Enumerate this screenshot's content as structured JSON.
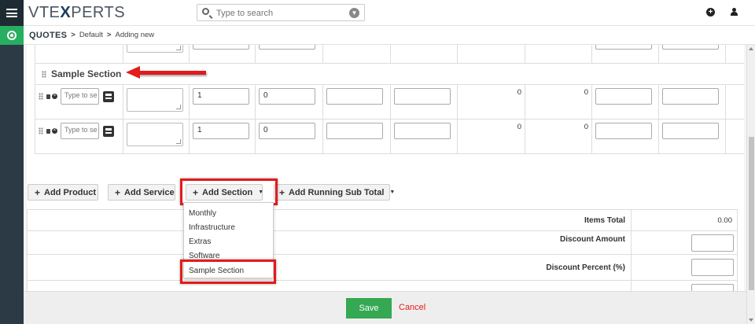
{
  "app": {
    "logo_prefix": "VTE",
    "logo_x": "X",
    "logo_suffix": "PERTS"
  },
  "search": {
    "placeholder": "Type to search"
  },
  "breadcrumb": {
    "module": "QUOTES",
    "sep1": ">",
    "item1": "Default",
    "sep2": ">",
    "item2": "Adding new"
  },
  "section": {
    "title": "Sample Section"
  },
  "rows": [
    {
      "product_placeholder": "Type to se",
      "quantity": "1",
      "list_price": "0",
      "total": "0",
      "net": "0"
    },
    {
      "product_placeholder": "Type to se",
      "quantity": "1",
      "list_price": "0",
      "total": "0",
      "net": "0"
    }
  ],
  "actions": {
    "add_product": "Add Product",
    "add_service": "Add Service",
    "add_section": "Add Section",
    "add_running_sub_total": "Add Running Sub Total"
  },
  "dropdown": {
    "options": [
      "Monthly",
      "Infrastructure",
      "Extras",
      "Software",
      "Sample Section"
    ]
  },
  "totals": {
    "items_total_label": "Items Total",
    "items_total_value": "0.00",
    "discount_amount_label": "Discount Amount",
    "discount_percent_label": "Discount Percent (%)"
  },
  "footer": {
    "save": "Save",
    "cancel": "Cancel"
  },
  "colors": {
    "accent_green": "#35a853",
    "highlight_red": "#e31b1b",
    "rail": "#2b3a44"
  }
}
